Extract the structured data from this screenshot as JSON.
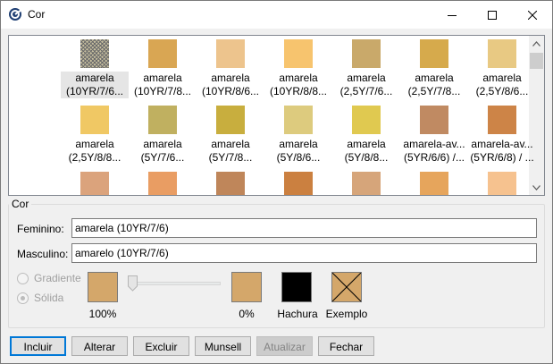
{
  "window": {
    "title": "Cor",
    "icon": "app-logo-icon"
  },
  "colors": [
    {
      "label": "amarela\n(10YR/7/6...",
      "color": "#c8c0a0",
      "hatched": true,
      "selected": true
    },
    {
      "label": "amarela\n(10YR/7/8...",
      "color": "#d9a653"
    },
    {
      "label": "amarela\n(10YR/8/6...",
      "color": "#edc48d"
    },
    {
      "label": "amarela\n(10YR/8/8...",
      "color": "#f7c46e"
    },
    {
      "label": "amarela\n(2,5Y/7/6...",
      "color": "#c9a96a"
    },
    {
      "label": "amarela\n(2,5Y/7/8...",
      "color": "#d6aa4c"
    },
    {
      "label": "amarela\n(2,5Y/8/6...",
      "color": "#e8c983"
    },
    {
      "label": "amarela\n(2,5Y/8/8...",
      "color": "#f0c864"
    },
    {
      "label": "amarela\n(5Y/7/6...",
      "color": "#c0b060"
    },
    {
      "label": "amarela\n(5Y/7/8...",
      "color": "#c8ae3e"
    },
    {
      "label": "amarela\n(5Y/8/6...",
      "color": "#ddcb7e"
    },
    {
      "label": "amarela\n(5Y/8/8...",
      "color": "#e0c950"
    },
    {
      "label": "amarela-av...\n(5YR/6/6) /...",
      "color": "#c08a62"
    },
    {
      "label": "amarela-av...\n(5YR/6/8) / ...",
      "color": "#cd8447"
    },
    {
      "label": "",
      "color": "#dba37c"
    },
    {
      "label": "",
      "color": "#e99d63"
    },
    {
      "label": "",
      "color": "#bf865a"
    },
    {
      "label": "",
      "color": "#cb8040"
    },
    {
      "label": "",
      "color": "#d6a57a"
    },
    {
      "label": "",
      "color": "#e6a55c"
    },
    {
      "label": "",
      "color": "#f6c28f"
    }
  ],
  "cor_group": {
    "legend": "Cor",
    "feminino_label": "Feminino:",
    "feminino_value": "amarela (10YR/7/6)",
    "masculino_label": "Masculino:",
    "masculino_value": "amarelo (10YR/7/6)",
    "gradiente_label": "Gradiente",
    "solida_label": "Sólida",
    "solida_checked": true,
    "start_color": "#d4a76a",
    "start_percent": "100%",
    "end_color": "#d4a76a",
    "end_percent": "0%",
    "slider_value_percent": 0,
    "hachura_color": "#000000",
    "hachura_label": "Hachura",
    "exemplo_color": "#d4a76a",
    "exemplo_label": "Exemplo"
  },
  "buttons": {
    "incluir": "Incluir",
    "alterar": "Alterar",
    "excluir": "Excluir",
    "munsell": "Munsell",
    "atualizar": "Atualizar",
    "fechar": "Fechar"
  }
}
